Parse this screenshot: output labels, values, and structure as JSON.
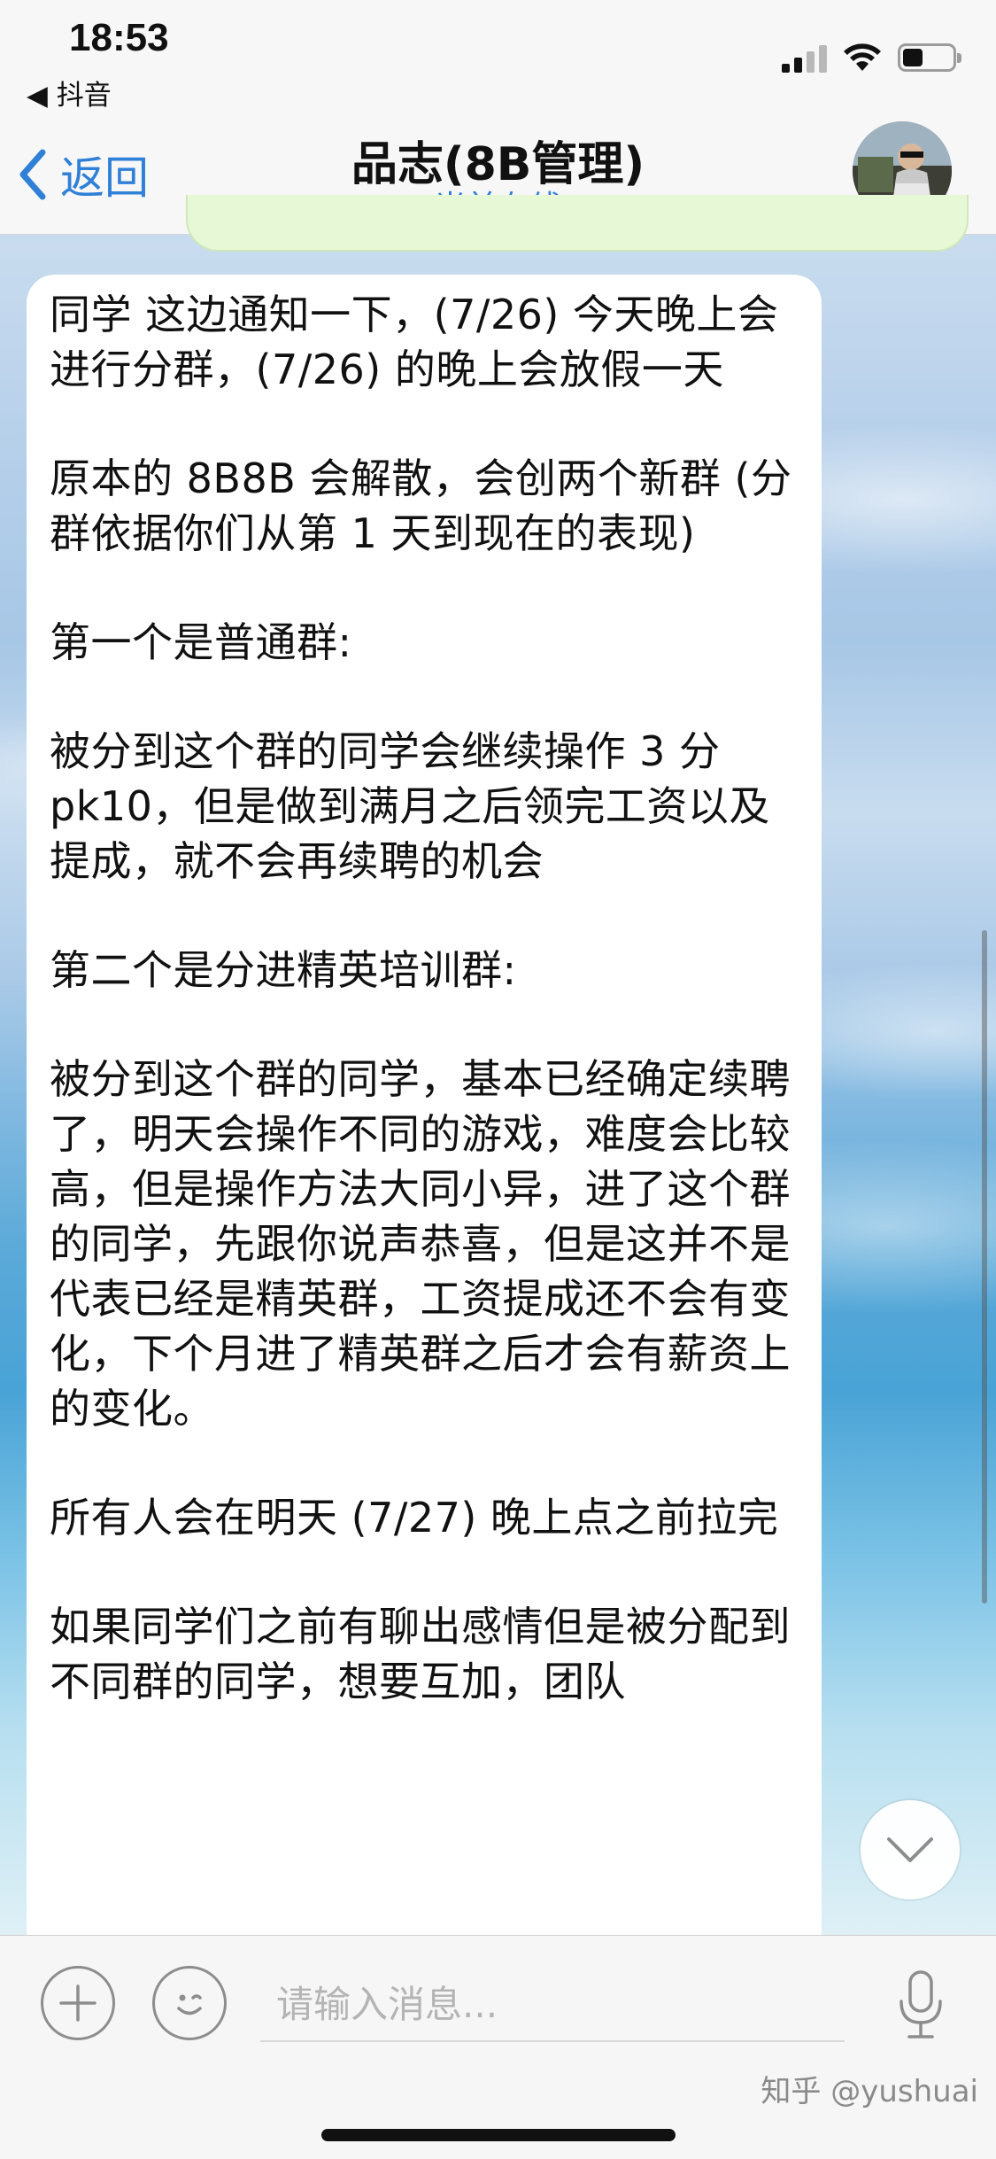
{
  "status_bar": {
    "time": "18:53",
    "back_app": "◀ 抖音"
  },
  "nav": {
    "back_label": "返回",
    "title": "品志(8B管理)",
    "subtitle": "当前在线"
  },
  "message": {
    "paragraphs": [
      "同学 这边通知一下，(7/26) 今天晚上会进行分群，(7/26) 的晚上会放假一天",
      "原本的 8B8B 会解散，会创两个新群 (分群依据你们从第 1 天到现在的表现)",
      "第一个是普通群:",
      "被分到这个群的同学会继续操作 3 分 pk10，但是做到满月之后领完工资以及提成，就不会再续聘的机会",
      "第二个是分进精英培训群:",
      "被分到这个群的同学，基本已经确定续聘了，明天会操作不同的游戏，难度会比较高，但是操作方法大同小异，进了这个群的同学，先跟你说声恭喜，但是这并不是代表已经是精英群，工资提成还不会有变化，下个月进了精英群之后才会有薪资上的变化。",
      "所有人会在明天 (7/27) 晚上点之前拉完",
      "如果同学们之前有聊出感情但是被分配到不同群的同学，想要互加，团队"
    ]
  },
  "input_bar": {
    "placeholder": "请输入消息..."
  },
  "watermark": "知乎 @yushuai",
  "colors": {
    "accent": "#2f80d6",
    "bubble_bg": "#ffffff",
    "bar_bg": "#f7f7f7"
  },
  "icons": {
    "back": "chevron-left-icon",
    "add": "plus-icon",
    "emoji": "emoji-icon",
    "mic": "microphone-icon",
    "scroll_down": "chevron-down-icon"
  }
}
